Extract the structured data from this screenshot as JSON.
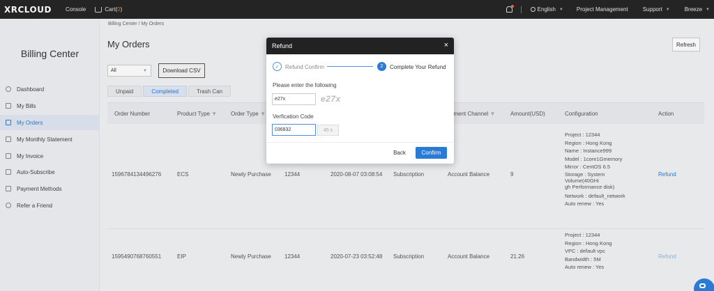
{
  "topbar": {
    "logo": "XRCLOUD",
    "console": "Console",
    "cart_label": "Cart(",
    "cart_count": "0",
    "cart_close": ")",
    "language": "English",
    "project_management": "Project Management",
    "support": "Support",
    "user": "Breeze"
  },
  "sidebar": {
    "title": "Billing Center",
    "items": [
      {
        "label": "Dashboard",
        "icon": "dashboard-icon"
      },
      {
        "label": "My Bills",
        "icon": "bills-icon"
      },
      {
        "label": "My Orders",
        "icon": "orders-icon",
        "active": true
      },
      {
        "label": "My Monthly Statement",
        "icon": "statement-icon"
      },
      {
        "label": "My Invoice",
        "icon": "invoice-icon"
      },
      {
        "label": "Auto-Subscribe",
        "icon": "subscribe-icon"
      },
      {
        "label": "Payment Methods",
        "icon": "payment-icon"
      },
      {
        "label": "Refer a Friend",
        "icon": "refer-icon"
      }
    ]
  },
  "main": {
    "breadcrumb": "Billing Center / My Orders",
    "title": "My Orders",
    "refresh": "Refresh",
    "filter_value": "All",
    "download_csv": "Download CSV",
    "tabs": [
      "Unpaid",
      "Completed",
      "Trash Can"
    ],
    "active_tab": "Completed",
    "columns": [
      "Order Number",
      "Product Type",
      "Order Type",
      "ayment Channel",
      "Amount(USD)",
      "Configuration",
      "Action"
    ],
    "rows": [
      {
        "order_number": "1596784134496276",
        "product_type": "ECS",
        "order_type": "Newly Purchase",
        "project": "12344",
        "time": "2020-08-07 03:08:54",
        "billing": "Subscription",
        "payment_channel": "Account Balance",
        "amount": "9",
        "configuration": [
          "Project : 12344",
          "Region : Hong Kong",
          "Name : Instance999",
          "Model : 1core1Gmemory",
          "Mirror : CentOS 6.5",
          "Storage : System Volume(40GHi",
          "gh Performance disk)",
          "Network : default_network",
          "Auto renew : Yes"
        ],
        "action": "Refund"
      },
      {
        "order_number": "1595490768760551",
        "product_type": "EIP",
        "order_type": "Newly Purchase",
        "project": "12344",
        "time": "2020-07-23 03:52:48",
        "billing": "Subscription",
        "payment_channel": "Account Balance",
        "amount": "21.26",
        "configuration": [
          "Project : 12344",
          "Region : Hong Kong",
          "VPC : default vpc",
          "Bandwidth : 5M",
          "Auto renew : Yes"
        ],
        "action": "Refund"
      }
    ]
  },
  "modal": {
    "title": "Refund",
    "close": "×",
    "step1_label": "Refund Confirm",
    "step2_number": "2",
    "step2_label": "Complete Your Refund",
    "prompt": "Please enter the following",
    "captcha_value": "e27x",
    "captcha_text": "e27x",
    "code_label": "Verfication Code",
    "code_value": "036832",
    "timer": "45 s",
    "back": "Back",
    "confirm": "Confirm"
  },
  "colors": {
    "accent": "#2b7bd6",
    "topbar": "#262626",
    "badge": "#e8743b"
  }
}
